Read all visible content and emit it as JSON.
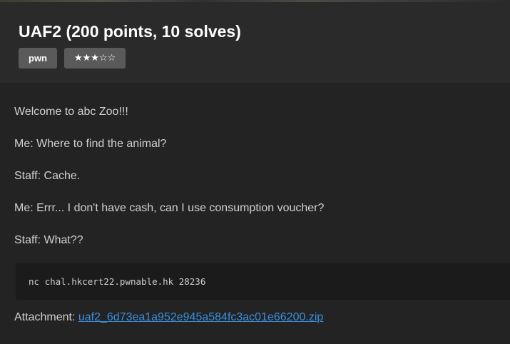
{
  "challenge": {
    "title": "UAF2 (200 points, 10 solves)",
    "tags": [
      {
        "label": "pwn"
      },
      {
        "label": "★★★☆☆"
      }
    ]
  },
  "description": {
    "paragraphs": [
      "Welcome to abc Zoo!!!",
      "Me: Where to find the animal?",
      "Staff: Cache.",
      "Me: Errr... I don't have cash, can I use consumption voucher?",
      "Staff: What??"
    ],
    "command": "nc chal.hkcert22.pwnable.hk 28236"
  },
  "attachment": {
    "label": "Attachment: ",
    "filename": "uaf2_6d73ea1a952e945a584fc3ac01e66200.zip"
  },
  "colors": {
    "background": "#232323",
    "header_background": "#2a2a2a",
    "tag_background": "#5a5a5a",
    "code_background": "#1b1b1b",
    "link": "#3a8fdd"
  }
}
